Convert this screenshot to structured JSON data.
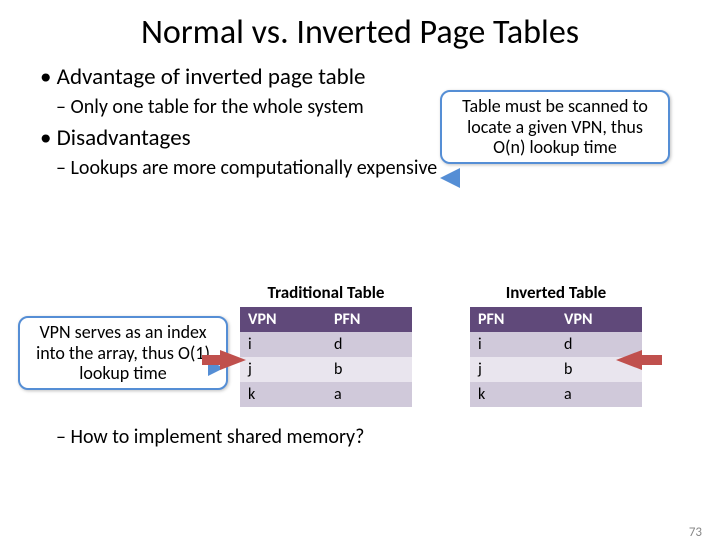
{
  "title": "Normal vs. Inverted Page Tables",
  "b1": "Advantage of inverted page table",
  "d1": "Only one table for the whole system",
  "b2": "Disadvantages",
  "d2": "Lookups are more computationally expensive",
  "d3": "How to implement shared memory?",
  "callout_right": "Table must be scanned to locate a given VPN, thus O(n) lookup time",
  "callout_left": "VPN serves as an index into the array, thus O(1) lookup time",
  "trad": {
    "title": "Traditional Table",
    "h1": "VPN",
    "h2": "PFN",
    "rows": [
      {
        "a": "i",
        "b": "d"
      },
      {
        "a": "j",
        "b": "b"
      },
      {
        "a": "k",
        "b": "a"
      }
    ]
  },
  "inv": {
    "title": "Inverted Table",
    "h1": "PFN",
    "h2": "VPN",
    "rows": [
      {
        "a": "i",
        "b": "d"
      },
      {
        "a": "j",
        "b": "b"
      },
      {
        "a": "k",
        "b": "a"
      }
    ]
  },
  "pagenum": "73"
}
